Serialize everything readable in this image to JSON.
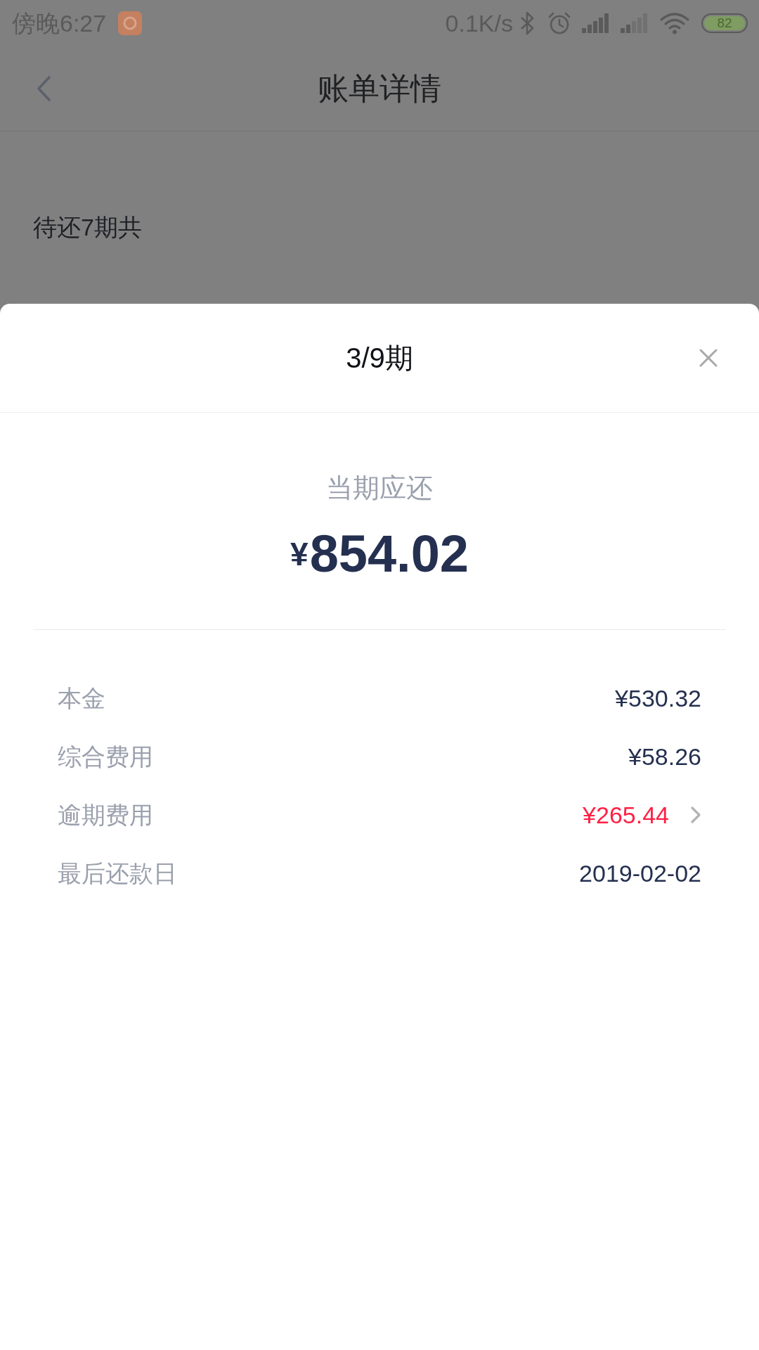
{
  "status_bar": {
    "time": "傍晚6:27",
    "network_speed": "0.1K/s",
    "battery": "82"
  },
  "nav_bar": {
    "title": "账单详情"
  },
  "summary": {
    "label": "待还7期共"
  },
  "sheet": {
    "title": "3/9期",
    "due_label": "当期应还",
    "due_currency": "¥",
    "due_amount": "854.02",
    "rows": [
      {
        "label": "本金",
        "value": "¥530.32",
        "color": "#253050",
        "kind": "plain"
      },
      {
        "label": "综合费用",
        "value": "¥58.26",
        "color": "#253050",
        "kind": "plain"
      },
      {
        "label": "逾期费用",
        "value": "¥265.44",
        "color": "#ff1f44",
        "kind": "link"
      },
      {
        "label": "最后还款日",
        "value": "2019-02-02",
        "color": "#253050",
        "kind": "plain"
      }
    ]
  }
}
